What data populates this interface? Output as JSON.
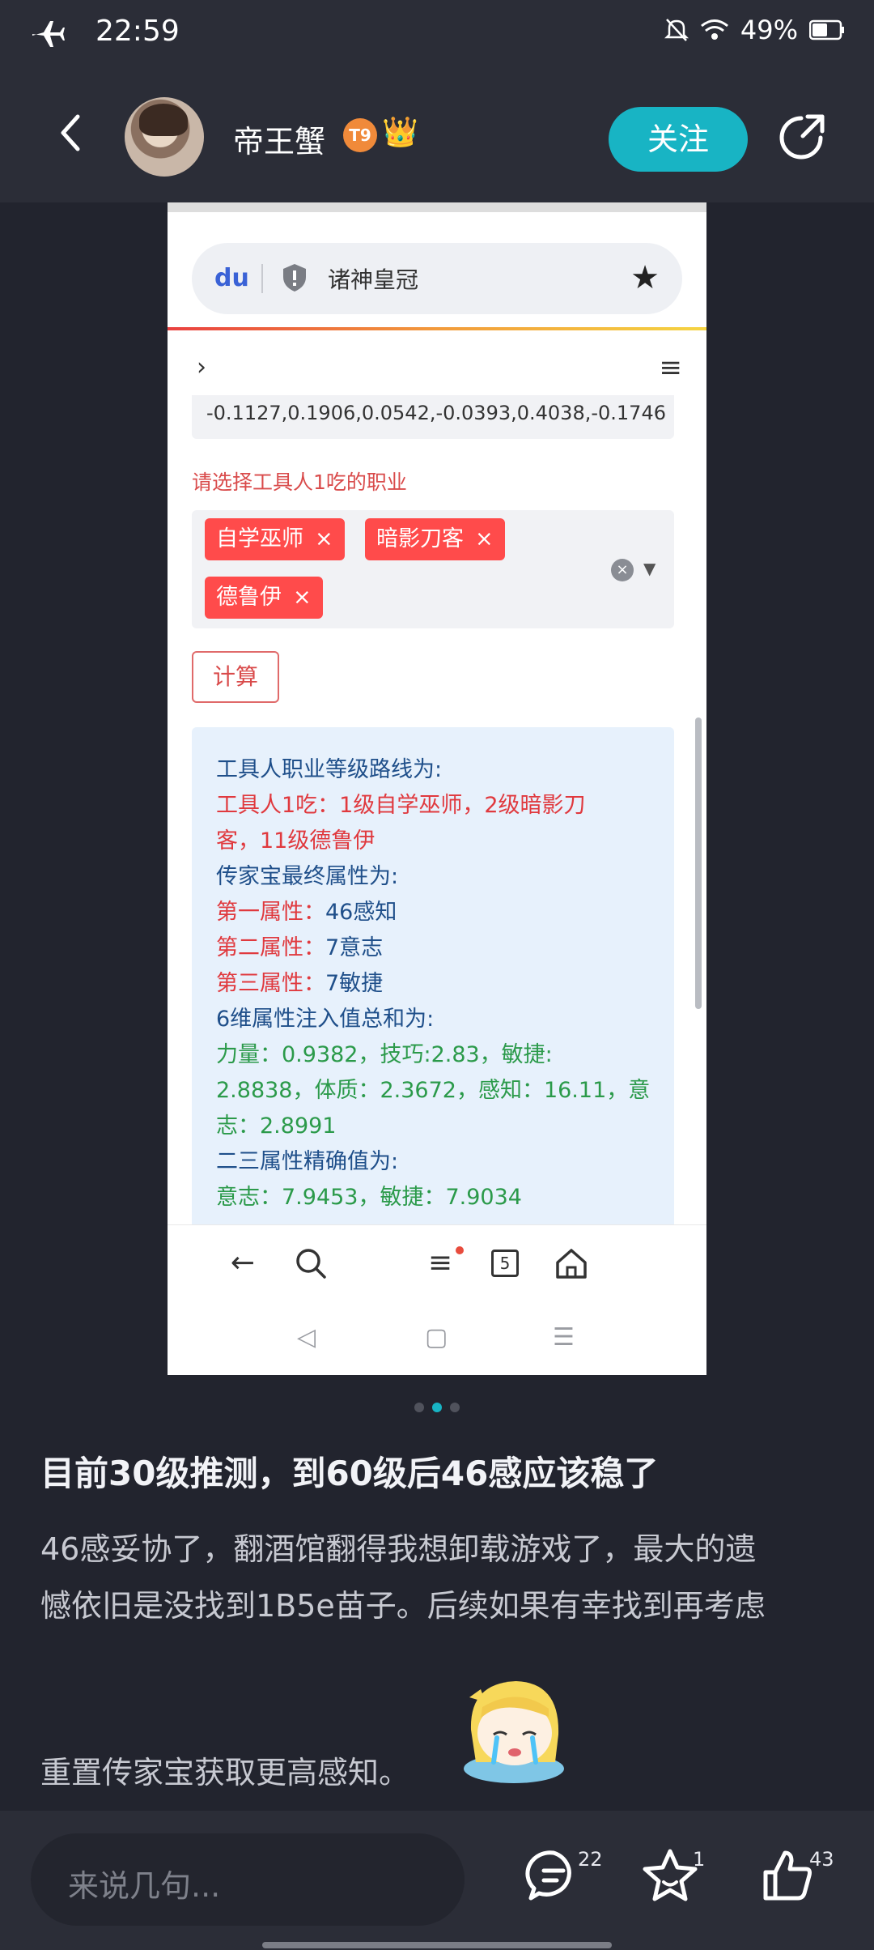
{
  "status_bar": {
    "time": "22:59",
    "battery": "49%"
  },
  "header": {
    "username": "帝王蟹",
    "level_badge": "T9",
    "follow_label": "关注"
  },
  "screenshot": {
    "url_title": "诸神皇冠",
    "code_values": "-0.1127,0.1906,0.0542,-0.0393,0.4038,-0.1746",
    "select_label": "请选择工具人1吃的职业",
    "tags": [
      {
        "label": "自学巫师"
      },
      {
        "label": "暗影刀客"
      },
      {
        "label": "德鲁伊"
      }
    ],
    "calc_label": "计算",
    "result_lines": [
      {
        "text": "工具人职业等级路线为:",
        "color": "blue"
      },
      {
        "text": "工具人1吃：1级自学巫师，2级暗影刀",
        "color": "red"
      },
      {
        "text": "客，11级德鲁伊",
        "color": "red"
      },
      {
        "text": "传家宝最终属性为:",
        "color": "blue"
      },
      {
        "text": "第一属性：",
        "value": "46感知",
        "color": "mix"
      },
      {
        "text": "第二属性：",
        "value": "7意志",
        "color": "mix"
      },
      {
        "text": "第三属性：",
        "value": "7敏捷",
        "color": "mix"
      },
      {
        "text": "6维属性注入值总和为:",
        "color": "blue"
      },
      {
        "text": "力量：0.9382，技巧:2.83，敏捷:",
        "color": "green"
      },
      {
        "text": "2.8838，体质：2.3672，感知：16.11，意",
        "color": "green"
      },
      {
        "text": "志：2.8991",
        "color": "green"
      },
      {
        "text": "二三属性精确值为:",
        "color": "blue"
      },
      {
        "text": "意志：7.9453，敏捷：7.9034",
        "color": "green"
      }
    ],
    "tab_count": "5"
  },
  "post": {
    "title": "目前30级推测，到60级后46感应该稳了",
    "body_lines": [
      "46感妥协了，翻酒馆翻得我想卸载游戏了，最大的遗",
      "憾依旧是没找到1B5e苗子。后续如果有幸找到再考虑",
      "重置传家宝获取更高感知。"
    ]
  },
  "bottom": {
    "comment_placeholder": "来说几句...",
    "comments_count": "22",
    "favorites_count": "1",
    "likes_count": "43"
  },
  "colors": {
    "accent": "#18b4c4",
    "tag_red": "#ff4b4b",
    "background": "#22242e"
  }
}
